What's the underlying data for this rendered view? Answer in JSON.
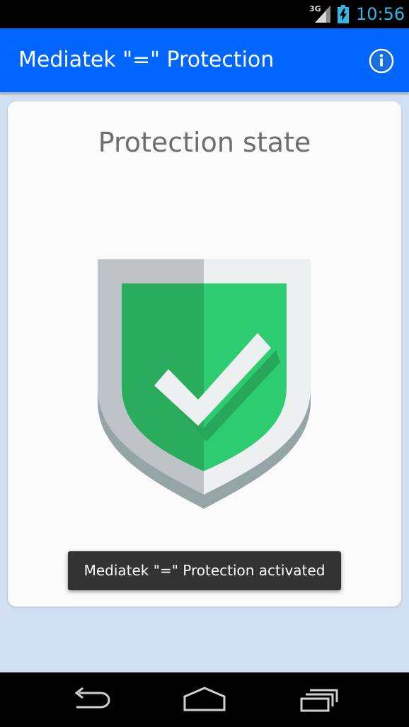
{
  "status_bar": {
    "network_type": "3G",
    "time": "10:56",
    "icons": [
      "signal-icon",
      "battery-charging-icon"
    ]
  },
  "app_bar": {
    "title": "Mediatek \"=\" Protection",
    "info_icon": "info-icon"
  },
  "card": {
    "title": "Protection state",
    "state_icon": "shield-check-icon",
    "state_colors": {
      "shield_green_dark": "#29ad5d",
      "shield_green_light": "#2ecc71",
      "shield_rim_dark": "#bdc3c7",
      "shield_rim_light": "#ecf0f1"
    }
  },
  "toast": {
    "message": "Mediatek \"=\" Protection activated"
  },
  "nav_bar": {
    "buttons": [
      "back-icon",
      "home-icon",
      "recent-apps-icon"
    ]
  },
  "colors": {
    "app_bar": "#0066ff",
    "background": "#cfdff0",
    "clock": "#33b5e5",
    "toast": "#333333"
  }
}
